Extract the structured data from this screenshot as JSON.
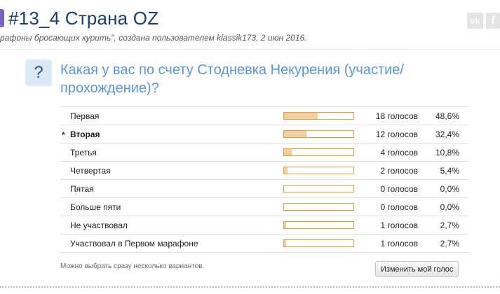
{
  "thread": {
    "title": "#13_4 Страна OZ",
    "meta": "рафоны бросающих курить\", создана пользователем klassik173, 2 июн 2016."
  },
  "share": {
    "vk_label": "vk",
    "fb_label": "f"
  },
  "poll": {
    "icon_symbol": "?",
    "question": "Какая у вас по счету Стодневка Некурения (участие/прохождение)?",
    "voted_marker": "*",
    "options": [
      {
        "label": "Первая",
        "votes": "18 голосов",
        "percent": "48,6%",
        "share": 0.486,
        "voted": false
      },
      {
        "label": "Вторая",
        "votes": "12 голосов",
        "percent": "32,4%",
        "share": 0.324,
        "voted": true
      },
      {
        "label": "Третья",
        "votes": "4 голосов",
        "percent": "10,8%",
        "share": 0.108,
        "voted": false
      },
      {
        "label": "Четвертая",
        "votes": "2 голосов",
        "percent": "5,4%",
        "share": 0.054,
        "voted": false
      },
      {
        "label": "Пятая",
        "votes": "0 голосов",
        "percent": "0,0%",
        "share": 0.0,
        "voted": false
      },
      {
        "label": "Больше пяти",
        "votes": "0 голосов",
        "percent": "0,0%",
        "share": 0.0,
        "voted": false
      },
      {
        "label": "Не участвовал",
        "votes": "1 голосов",
        "percent": "2,7%",
        "share": 0.027,
        "voted": false
      },
      {
        "label": "Участвовал в Первом марафоне",
        "votes": "1 голосов",
        "percent": "2,7%",
        "share": 0.027,
        "voted": false
      }
    ],
    "footer_note": "Можно выбрать сразу несколько вариантов.",
    "change_vote_label": "Изменить мой голос"
  },
  "colors": {
    "title": "#1d3e6a",
    "question": "#5a97cf",
    "bar_fill": "#f4cf9e",
    "bar_border": "#d8a050",
    "prefix_badge": "#7a64c8"
  },
  "icons": {
    "prefix": "prefix-badge-icon",
    "question": "question-mark-icon",
    "vk": "vk-icon",
    "facebook": "facebook-icon"
  }
}
